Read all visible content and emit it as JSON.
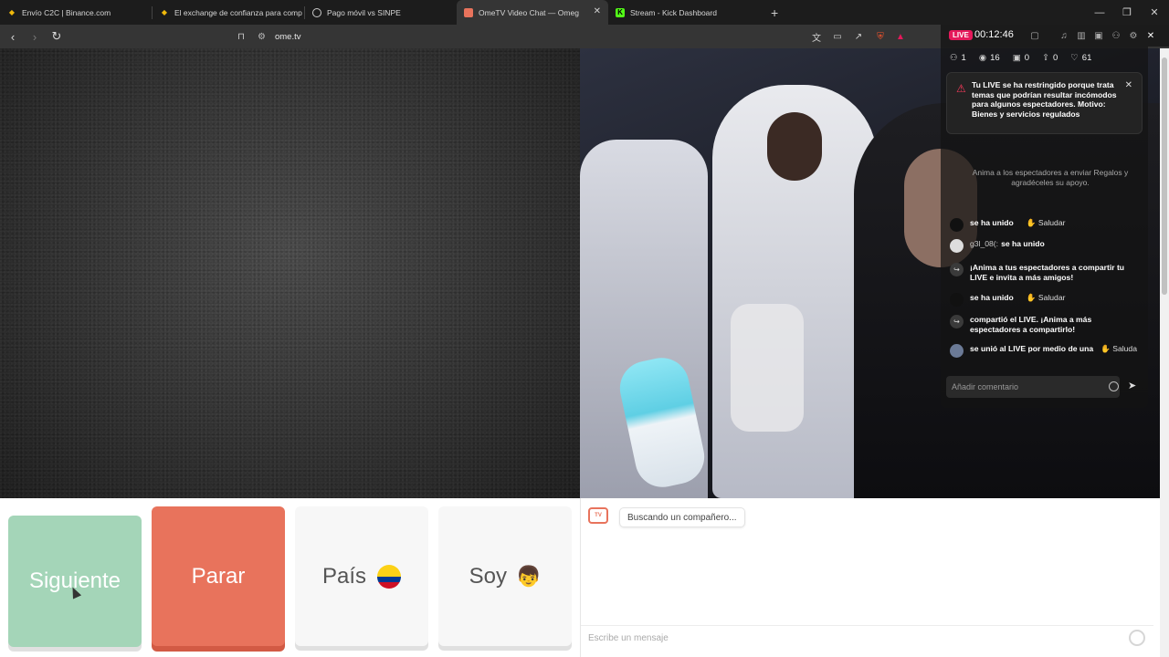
{
  "tabs": [
    {
      "title": "Envío C2C | Binance.com",
      "favicon": "binance-icon",
      "active": false
    },
    {
      "title": "El exchange de confianza para comp",
      "favicon": "binance-icon",
      "active": false
    },
    {
      "title": "Pago móvil vs SINPE",
      "favicon": "globe-icon",
      "active": false
    },
    {
      "title": "OmeTV Video Chat — Omeg",
      "favicon": "ometv-icon",
      "active": true
    },
    {
      "title": "Stream - Kick Dashboard",
      "favicon": "kick-icon",
      "active": false
    }
  ],
  "address_bar": {
    "url": "ome.tv"
  },
  "live": {
    "badge": "LIVE",
    "time": "00:12:46",
    "stats": {
      "viewers_joined": "1",
      "views": "16",
      "gifts": "0",
      "shares": "0",
      "likes": "61"
    },
    "warning": "Tu LIVE se ha restringido porque trata temas que podrían resultar incómodos para algunos espectadores. Motivo: Bienes y servicios regulados",
    "encourage": "Anima a los espectadores a enviar Regalos y agradéceles su apoyo.",
    "feed": [
      {
        "name": "",
        "text": "se ha unido",
        "action": "Saludar"
      },
      {
        "name": "g3l_08(:",
        "text": "se ha unido",
        "action": ""
      },
      {
        "name": "",
        "text": "¡Anima a tus espectadores a compartir tu LIVE e invita a más amigos!",
        "action": ""
      },
      {
        "name": "",
        "text": "se ha unido",
        "action": "Saludar"
      },
      {
        "name": "",
        "text": "compartió el LIVE. ¡Anima a más espectadores a compartirlo!",
        "action": ""
      },
      {
        "name": "",
        "text": "se unió al LIVE por medio de una",
        "action": "Saluda"
      }
    ],
    "comment_placeholder": "Añadir comentario"
  },
  "controls": {
    "next": "Siguiente",
    "stop": "Parar",
    "country": "País",
    "me": "Soy"
  },
  "chat": {
    "status": "Buscando un compañero...",
    "placeholder": "Escribe un mensaje"
  },
  "colors": {
    "next_button": "#a4d5b8",
    "stop_button": "#e8735c",
    "live_badge": "#e5195b"
  }
}
